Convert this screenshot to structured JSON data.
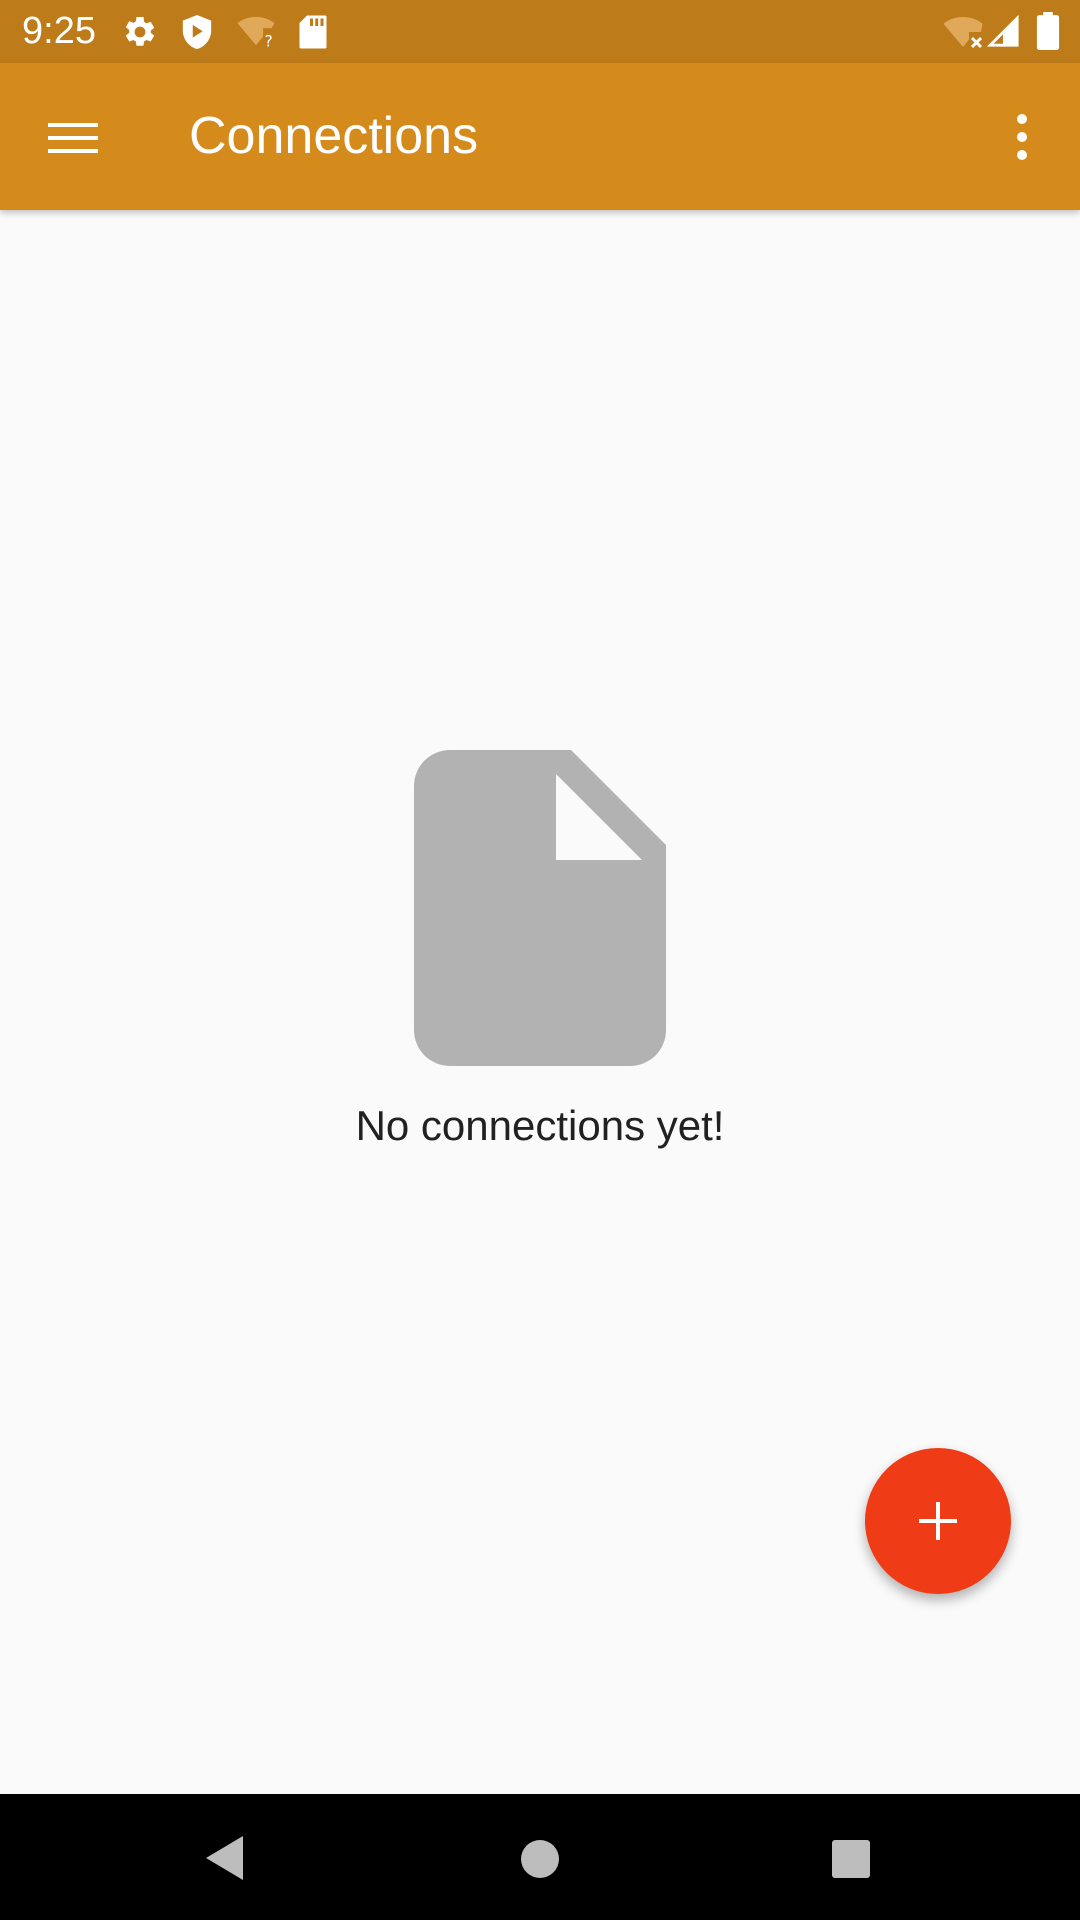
{
  "status_bar": {
    "time": "9:25",
    "left_icons": [
      "settings-icon",
      "shield-icon",
      "wifi-question-icon",
      "sd-card-icon"
    ],
    "right_icons": [
      "wifi-off-icon",
      "signal-icon",
      "battery-icon"
    ]
  },
  "app_bar": {
    "title": "Connections",
    "background": "#d58a1c",
    "nav_icon": "menu-icon",
    "action_icon": "more-vert-icon"
  },
  "empty_state": {
    "icon": "file-icon",
    "message": "No connections yet!"
  },
  "fab": {
    "icon": "plus-icon",
    "color": "#ef3b16"
  },
  "nav_bar": {
    "buttons": [
      "back-icon",
      "home-icon",
      "recents-icon"
    ]
  }
}
